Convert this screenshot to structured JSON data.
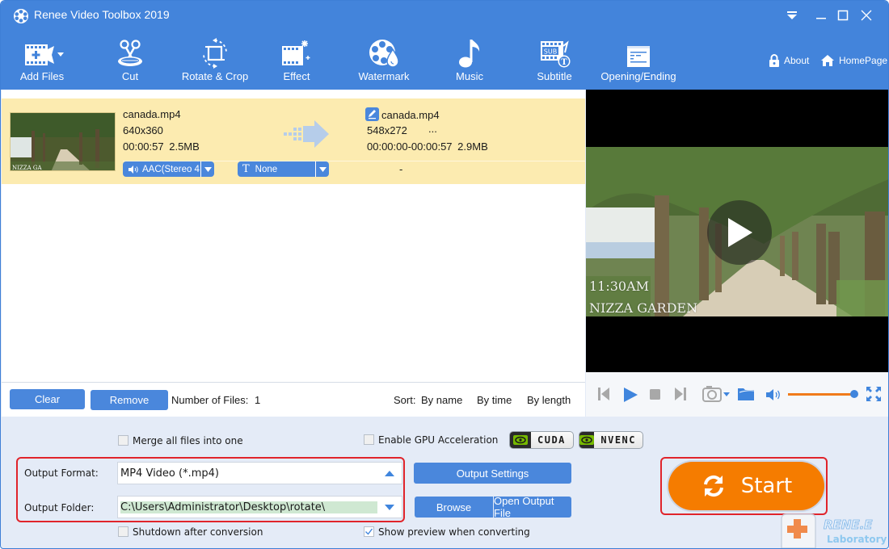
{
  "app": {
    "title": "Renee Video Toolbox 2019"
  },
  "window_controls": {
    "menu": "menu-dropdown",
    "minimize": "minimize",
    "maximize": "maximize",
    "close": "close"
  },
  "toolbar": {
    "items": [
      {
        "label": "Add Files",
        "icon": "add-files-icon"
      },
      {
        "label": "Cut",
        "icon": "scissors-icon"
      },
      {
        "label": "Rotate & Crop",
        "icon": "rotate-crop-icon"
      },
      {
        "label": "Effect",
        "icon": "effect-icon"
      },
      {
        "label": "Watermark",
        "icon": "watermark-icon"
      },
      {
        "label": "Music",
        "icon": "music-note-icon"
      },
      {
        "label": "Subtitle",
        "icon": "subtitle-icon"
      },
      {
        "label": "Opening/Ending",
        "icon": "opening-ending-icon"
      }
    ],
    "about_label": "About",
    "homepage_label": "HomePage"
  },
  "file_list": {
    "items": [
      {
        "source": {
          "name": "canada.mp4",
          "resolution": "640x360",
          "duration": "00:00:57",
          "size": "2.5MB",
          "thumb_caption": "NIZZA GA"
        },
        "output": {
          "name": "canada.mp4",
          "resolution": "548x272",
          "more": "...",
          "range": "00:00:00-00:00:57",
          "size": "2.9MB"
        },
        "audio_track": "AAC(Stereo 4",
        "subtitle_track": "None",
        "extra": "-"
      }
    ]
  },
  "list_bar": {
    "clear_label": "Clear",
    "remove_label": "Remove",
    "count_label": "Number of Files:",
    "count_value": "1",
    "sort_label": "Sort:",
    "sort_by_name": "By name",
    "sort_by_time": "By time",
    "sort_by_length": "By length"
  },
  "preview": {
    "overlay_time": "11:30AM",
    "overlay_place": "NIZZA GARDEN",
    "volume_fraction": 1.0
  },
  "settings": {
    "merge_label": "Merge all files into one",
    "merge_checked": false,
    "gpu_label": "Enable GPU Acceleration",
    "gpu_checked": false,
    "cuda_label": "CUDA",
    "nvenc_label": "NVENC",
    "output_format_label": "Output Format:",
    "output_format_value": "MP4 Video (*.mp4)",
    "output_folder_label": "Output Folder:",
    "output_folder_value": "C:\\Users\\Administrator\\Desktop\\rotate\\",
    "output_settings_label": "Output Settings",
    "browse_label": "Browse",
    "open_output_label": "Open Output File",
    "shutdown_label": "Shutdown after conversion",
    "shutdown_checked": false,
    "show_preview_label": "Show preview when converting",
    "show_preview_checked": true,
    "start_label": "Start"
  },
  "brand": {
    "name": "RENE.E",
    "sub": "Laboratory"
  },
  "colors": {
    "toolbar_blue": "#4384db",
    "button_blue": "#4a87dc",
    "selected_row": "#fcebb0",
    "start_orange": "#f57c00",
    "highlight_red": "#e0242b",
    "folder_highlight": "#cfe8d2"
  }
}
